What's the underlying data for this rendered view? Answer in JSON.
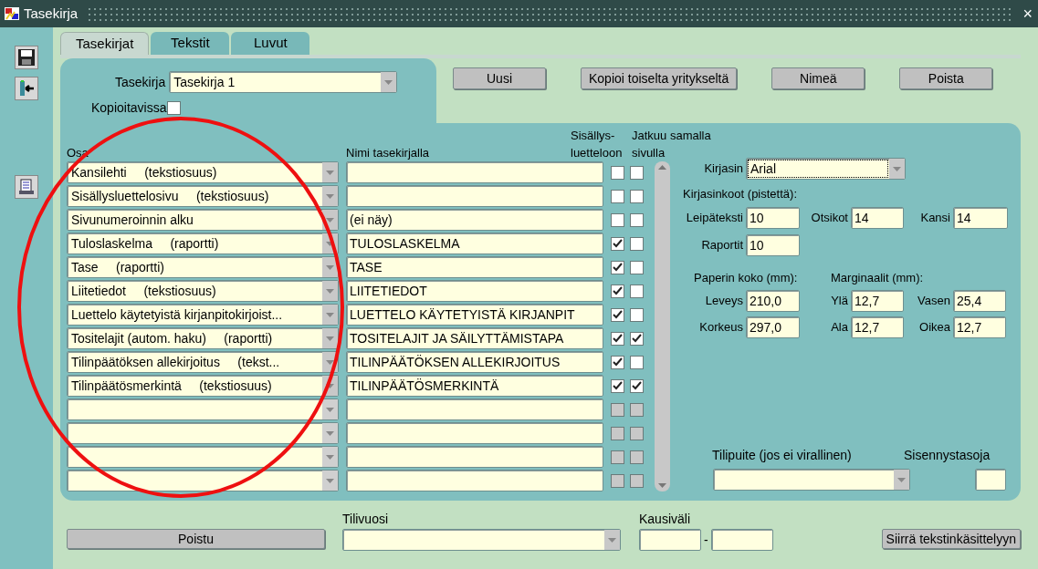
{
  "window": {
    "title": "Tasekirja",
    "close": "×"
  },
  "toolbar": [
    {
      "kind": "save"
    },
    {
      "kind": "exit"
    },
    {
      "kind": "print"
    }
  ],
  "tabs": [
    {
      "label": "Tasekirjat",
      "selected": true
    },
    {
      "label": "Tekstit",
      "selected": false
    },
    {
      "label": "Luvut",
      "selected": false
    }
  ],
  "tasekirja": {
    "label": "Tasekirja",
    "value": "Tasekirja 1"
  },
  "kopioitavissa": {
    "label": "Kopioitavissa",
    "checked": false
  },
  "actions": [
    "Uusi",
    "Kopioi toiselta yritykseltä",
    "Nimeä",
    "Poista"
  ],
  "table": {
    "columns": [
      {
        "lines": [
          "Osa"
        ]
      },
      {
        "lines": [
          "Nimi tasekirjalla"
        ]
      },
      {
        "lines": [
          "Sisällys-",
          "luetteloon"
        ]
      },
      {
        "lines": [
          "Jatkuu samalla",
          "sivulla"
        ]
      }
    ],
    "rows": [
      {
        "osa": "Kansilehti     (tekstiosuus)",
        "name": "",
        "in_toc": false,
        "continues": false,
        "disabled": false
      },
      {
        "osa": "Sisällysluettelosivu     (tekstiosuus)",
        "name": "",
        "in_toc": false,
        "continues": false,
        "disabled": false
      },
      {
        "osa": "Sivunumeroinnin alku",
        "name": "(ei näy)",
        "in_toc": false,
        "continues": false,
        "disabled": false
      },
      {
        "osa": "Tuloslaskelma     (raportti)",
        "name": "TULOSLASKELMA",
        "in_toc": true,
        "continues": false,
        "disabled": false
      },
      {
        "osa": "Tase     (raportti)",
        "name": "TASE",
        "in_toc": true,
        "continues": false,
        "disabled": false
      },
      {
        "osa": "Liitetiedot     (tekstiosuus)",
        "name": "LIITETIEDOT",
        "in_toc": true,
        "continues": false,
        "disabled": false
      },
      {
        "osa": "Luettelo käytetyistä kirjanpitokirjoist...",
        "name": "LUETTELO KÄYTETYISTÄ KIRJANPIT",
        "in_toc": true,
        "continues": false,
        "disabled": false
      },
      {
        "osa": "Tositelajit (autom. haku)     (raportti)",
        "name": "TOSITELAJIT JA SÄILYTTÄMISTAPA",
        "in_toc": true,
        "continues": true,
        "disabled": false
      },
      {
        "osa": "Tilinpäätöksen allekirjoitus     (tekst...",
        "name": "TILINPÄÄTÖKSEN ALLEKIRJOITUS",
        "in_toc": true,
        "continues": false,
        "disabled": false
      },
      {
        "osa": "Tilinpäätösmerkintä     (tekstiosuus)",
        "name": "TILINPÄÄTÖSMERKINTÄ",
        "in_toc": true,
        "continues": true,
        "disabled": false
      },
      {
        "osa": "",
        "name": "",
        "in_toc": false,
        "continues": false,
        "disabled": true
      },
      {
        "osa": "",
        "name": "",
        "in_toc": false,
        "continues": false,
        "disabled": true
      },
      {
        "osa": "",
        "name": "",
        "in_toc": false,
        "continues": false,
        "disabled": true
      },
      {
        "osa": "",
        "name": "",
        "in_toc": false,
        "continues": false,
        "disabled": true
      }
    ]
  },
  "font": {
    "label": "Kirjasin",
    "value": "Arial"
  },
  "font_sizes": {
    "title": "Kirjasinkoot (pistettä):",
    "fields": [
      {
        "label": "Leipäteksti",
        "value": "10"
      },
      {
        "label": "Otsikot",
        "value": "14"
      },
      {
        "label": "Kansi",
        "value": "14"
      },
      {
        "label": "Raportit",
        "value": "10"
      }
    ]
  },
  "paper": {
    "title": "Paperin koko (mm):",
    "fields": [
      {
        "label": "Leveys",
        "value": "210,0"
      },
      {
        "label": "Korkeus",
        "value": "297,0"
      }
    ]
  },
  "margins": {
    "title": "Marginaalit (mm):",
    "fields": [
      {
        "label": "Ylä",
        "value": "12,7"
      },
      {
        "label": "Vasen",
        "value": "25,4"
      },
      {
        "label": "Ala",
        "value": "12,7"
      },
      {
        "label": "Oikea",
        "value": "12,7"
      }
    ]
  },
  "tilipuite": {
    "label": "Tilipuite (jos ei virallinen)"
  },
  "sisennystasoja": {
    "label": "Sisennystasoja"
  },
  "poistu": "Poistu",
  "tilivuosi": {
    "label": "Tilivuosi"
  },
  "kausivali": {
    "label": "Kausiväli",
    "separator": "-"
  },
  "transfer": "Siirrä tekstinkäsittelyyn",
  "annotation": {
    "kind": "ellipse"
  }
}
